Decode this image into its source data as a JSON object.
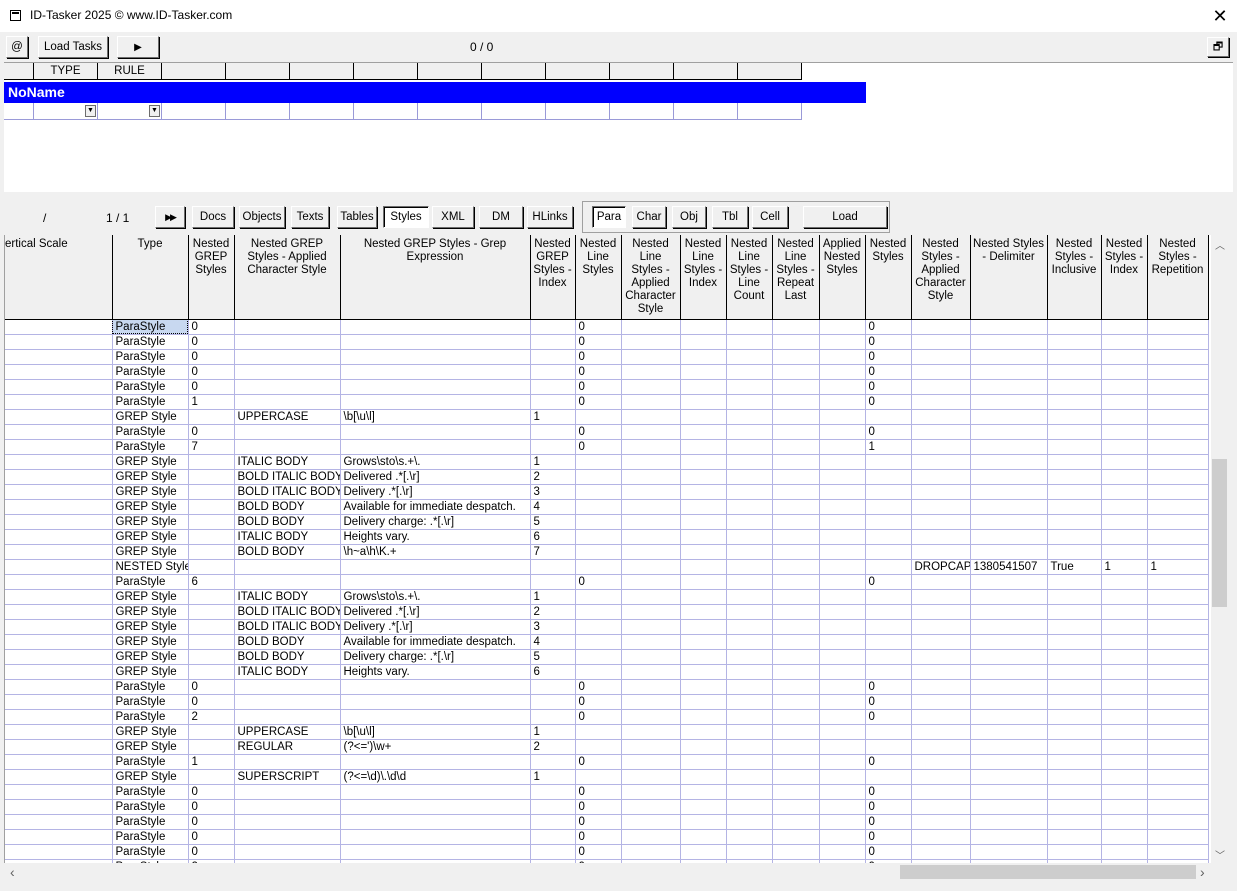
{
  "window": {
    "title": "ID-Tasker 2025  © www.ID-Tasker.com",
    "close_glyph": "✕"
  },
  "toolbar": {
    "at_label": "@",
    "load_tasks_label": "Load Tasks",
    "play_glyph": "▶",
    "counter": "0 / 0",
    "restore_glyph": "🗗"
  },
  "rules": {
    "headers": [
      "",
      "TYPE",
      "RULE",
      "",
      "",
      "",
      "",
      "",
      "",
      "",
      "",
      "",
      ""
    ],
    "group_name": "NoName"
  },
  "nav": {
    "slash": "/",
    "page": "1 / 1",
    "fast_forward_glyph": "▶▶",
    "tabs": [
      "Docs",
      "Objects",
      "Texts",
      "Tables",
      "Styles",
      "XML",
      "DM",
      "HLinks"
    ],
    "active_tab": "Styles",
    "sub_tabs": [
      "Para",
      "Char",
      "Obj",
      "Tbl",
      "Cell"
    ],
    "active_sub_tab": "Para",
    "load_label": "Load"
  },
  "grid": {
    "columns": [
      "ertical Scale",
      "Type",
      "Nested GREP Styles",
      "Nested GREP Styles - Applied Character Style",
      "Nested GREP Styles - Grep Expression",
      "Nested GREP Styles - Index",
      "Nested Line Styles",
      "Nested Line Styles - Applied Character Style",
      "Nested Line Styles - Index",
      "Nested Line Styles - Line Count",
      "Nested Line Styles - Repeat Last",
      "Applied Nested Styles",
      "Nested Styles",
      "Nested Styles - Applied Character Style",
      "Nested Styles - Delimiter",
      "Nested Styles - Inclusive",
      "Nested Styles - Index",
      "Nested Styles - Repetition"
    ],
    "rows": [
      [
        "",
        "ParaStyle",
        "0",
        "",
        "",
        "",
        "0",
        "",
        "",
        "",
        "",
        "",
        "0",
        "",
        "",
        "",
        "",
        ""
      ],
      [
        "",
        "ParaStyle",
        "0",
        "",
        "",
        "",
        "0",
        "",
        "",
        "",
        "",
        "",
        "0",
        "",
        "",
        "",
        "",
        ""
      ],
      [
        "",
        "ParaStyle",
        "0",
        "",
        "",
        "",
        "0",
        "",
        "",
        "",
        "",
        "",
        "0",
        "",
        "",
        "",
        "",
        ""
      ],
      [
        "",
        "ParaStyle",
        "0",
        "",
        "",
        "",
        "0",
        "",
        "",
        "",
        "",
        "",
        "0",
        "",
        "",
        "",
        "",
        ""
      ],
      [
        "",
        "ParaStyle",
        "0",
        "",
        "",
        "",
        "0",
        "",
        "",
        "",
        "",
        "",
        "0",
        "",
        "",
        "",
        "",
        ""
      ],
      [
        "",
        "ParaStyle",
        "1",
        "",
        "",
        "",
        "0",
        "",
        "",
        "",
        "",
        "",
        "0",
        "",
        "",
        "",
        "",
        ""
      ],
      [
        "",
        "GREP Style",
        "",
        "UPPERCASE",
        "\\b[\\u\\l]",
        "1",
        "",
        "",
        "",
        "",
        "",
        "",
        "",
        "",
        "",
        "",
        "",
        ""
      ],
      [
        "",
        "ParaStyle",
        "0",
        "",
        "",
        "",
        "0",
        "",
        "",
        "",
        "",
        "",
        "0",
        "",
        "",
        "",
        "",
        ""
      ],
      [
        "",
        "ParaStyle",
        "7",
        "",
        "",
        "",
        "0",
        "",
        "",
        "",
        "",
        "",
        "1",
        "",
        "",
        "",
        "",
        ""
      ],
      [
        "",
        "GREP Style",
        "",
        "ITALIC BODY",
        "Grows\\sto\\s.+\\.",
        "1",
        "",
        "",
        "",
        "",
        "",
        "",
        "",
        "",
        "",
        "",
        "",
        ""
      ],
      [
        "",
        "GREP Style",
        "",
        "BOLD ITALIC BODY",
        "Delivered .*[.\\r]",
        "2",
        "",
        "",
        "",
        "",
        "",
        "",
        "",
        "",
        "",
        "",
        "",
        ""
      ],
      [
        "",
        "GREP Style",
        "",
        "BOLD ITALIC BODY",
        "Delivery .*[.\\r]",
        "3",
        "",
        "",
        "",
        "",
        "",
        "",
        "",
        "",
        "",
        "",
        "",
        ""
      ],
      [
        "",
        "GREP Style",
        "",
        "BOLD BODY",
        "Available for immediate despatch.",
        "4",
        "",
        "",
        "",
        "",
        "",
        "",
        "",
        "",
        "",
        "",
        "",
        ""
      ],
      [
        "",
        "GREP Style",
        "",
        "BOLD BODY",
        "Delivery charge: .*[.\\r]",
        "5",
        "",
        "",
        "",
        "",
        "",
        "",
        "",
        "",
        "",
        "",
        "",
        ""
      ],
      [
        "",
        "GREP Style",
        "",
        "ITALIC BODY",
        "Heights vary.",
        "6",
        "",
        "",
        "",
        "",
        "",
        "",
        "",
        "",
        "",
        "",
        "",
        ""
      ],
      [
        "",
        "GREP Style",
        "",
        "BOLD BODY",
        "\\h~a\\h\\K.+",
        "7",
        "",
        "",
        "",
        "",
        "",
        "",
        "",
        "",
        "",
        "",
        "",
        ""
      ],
      [
        "",
        "NESTED Style",
        "",
        "",
        "",
        "",
        "",
        "",
        "",
        "",
        "",
        "",
        "",
        "DROPCAP",
        "1380541507",
        "True",
        "1",
        "1"
      ],
      [
        "",
        "ParaStyle",
        "6",
        "",
        "",
        "",
        "0",
        "",
        "",
        "",
        "",
        "",
        "0",
        "",
        "",
        "",
        "",
        ""
      ],
      [
        "",
        "GREP Style",
        "",
        "ITALIC BODY",
        "Grows\\sto\\s.+\\.",
        "1",
        "",
        "",
        "",
        "",
        "",
        "",
        "",
        "",
        "",
        "",
        "",
        ""
      ],
      [
        "",
        "GREP Style",
        "",
        "BOLD ITALIC BODY",
        "Delivered .*[.\\r]",
        "2",
        "",
        "",
        "",
        "",
        "",
        "",
        "",
        "",
        "",
        "",
        "",
        ""
      ],
      [
        "",
        "GREP Style",
        "",
        "BOLD ITALIC BODY",
        "Delivery .*[.\\r]",
        "3",
        "",
        "",
        "",
        "",
        "",
        "",
        "",
        "",
        "",
        "",
        "",
        ""
      ],
      [
        "",
        "GREP Style",
        "",
        "BOLD BODY",
        "Available for immediate despatch.",
        "4",
        "",
        "",
        "",
        "",
        "",
        "",
        "",
        "",
        "",
        "",
        "",
        ""
      ],
      [
        "",
        "GREP Style",
        "",
        "BOLD BODY",
        "Delivery charge: .*[.\\r]",
        "5",
        "",
        "",
        "",
        "",
        "",
        "",
        "",
        "",
        "",
        "",
        "",
        ""
      ],
      [
        "",
        "GREP Style",
        "",
        "ITALIC BODY",
        "Heights vary.",
        "6",
        "",
        "",
        "",
        "",
        "",
        "",
        "",
        "",
        "",
        "",
        "",
        ""
      ],
      [
        "",
        "ParaStyle",
        "0",
        "",
        "",
        "",
        "0",
        "",
        "",
        "",
        "",
        "",
        "0",
        "",
        "",
        "",
        "",
        ""
      ],
      [
        "",
        "ParaStyle",
        "0",
        "",
        "",
        "",
        "0",
        "",
        "",
        "",
        "",
        "",
        "0",
        "",
        "",
        "",
        "",
        ""
      ],
      [
        "",
        "ParaStyle",
        "2",
        "",
        "",
        "",
        "0",
        "",
        "",
        "",
        "",
        "",
        "0",
        "",
        "",
        "",
        "",
        ""
      ],
      [
        "",
        "GREP Style",
        "",
        "UPPERCASE",
        "\\b[\\u\\l]",
        "1",
        "",
        "",
        "",
        "",
        "",
        "",
        "",
        "",
        "",
        "",
        "",
        ""
      ],
      [
        "",
        "GREP Style",
        "",
        "REGULAR",
        "(?<=')\\w+",
        "2",
        "",
        "",
        "",
        "",
        "",
        "",
        "",
        "",
        "",
        "",
        "",
        ""
      ],
      [
        "",
        "ParaStyle",
        "1",
        "",
        "",
        "",
        "0",
        "",
        "",
        "",
        "",
        "",
        "0",
        "",
        "",
        "",
        "",
        ""
      ],
      [
        "",
        "GREP Style",
        "",
        "SUPERSCRIPT",
        "(?<=\\d)\\.\\d\\d",
        "1",
        "",
        "",
        "",
        "",
        "",
        "",
        "",
        "",
        "",
        "",
        "",
        ""
      ],
      [
        "",
        "ParaStyle",
        "0",
        "",
        "",
        "",
        "0",
        "",
        "",
        "",
        "",
        "",
        "0",
        "",
        "",
        "",
        "",
        ""
      ],
      [
        "",
        "ParaStyle",
        "0",
        "",
        "",
        "",
        "0",
        "",
        "",
        "",
        "",
        "",
        "0",
        "",
        "",
        "",
        "",
        ""
      ],
      [
        "",
        "ParaStyle",
        "0",
        "",
        "",
        "",
        "0",
        "",
        "",
        "",
        "",
        "",
        "0",
        "",
        "",
        "",
        "",
        ""
      ],
      [
        "",
        "ParaStyle",
        "0",
        "",
        "",
        "",
        "0",
        "",
        "",
        "",
        "",
        "",
        "0",
        "",
        "",
        "",
        "",
        ""
      ],
      [
        "",
        "ParaStyle",
        "0",
        "",
        "",
        "",
        "0",
        "",
        "",
        "",
        "",
        "",
        "0",
        "",
        "",
        "",
        "",
        ""
      ],
      [
        "",
        "ParaStyle",
        "2",
        "",
        "",
        "",
        "0",
        "",
        "",
        "",
        "",
        "",
        "0",
        "",
        "",
        "",
        "",
        ""
      ]
    ]
  },
  "scroll": {
    "up_glyph": "︿",
    "down_glyph": "﹀",
    "left_glyph": "‹",
    "right_glyph": "›"
  },
  "colors": {
    "group_bar": "#0000ff",
    "grid_line": "#b4b4e4",
    "selection": "#c8d8f0"
  }
}
